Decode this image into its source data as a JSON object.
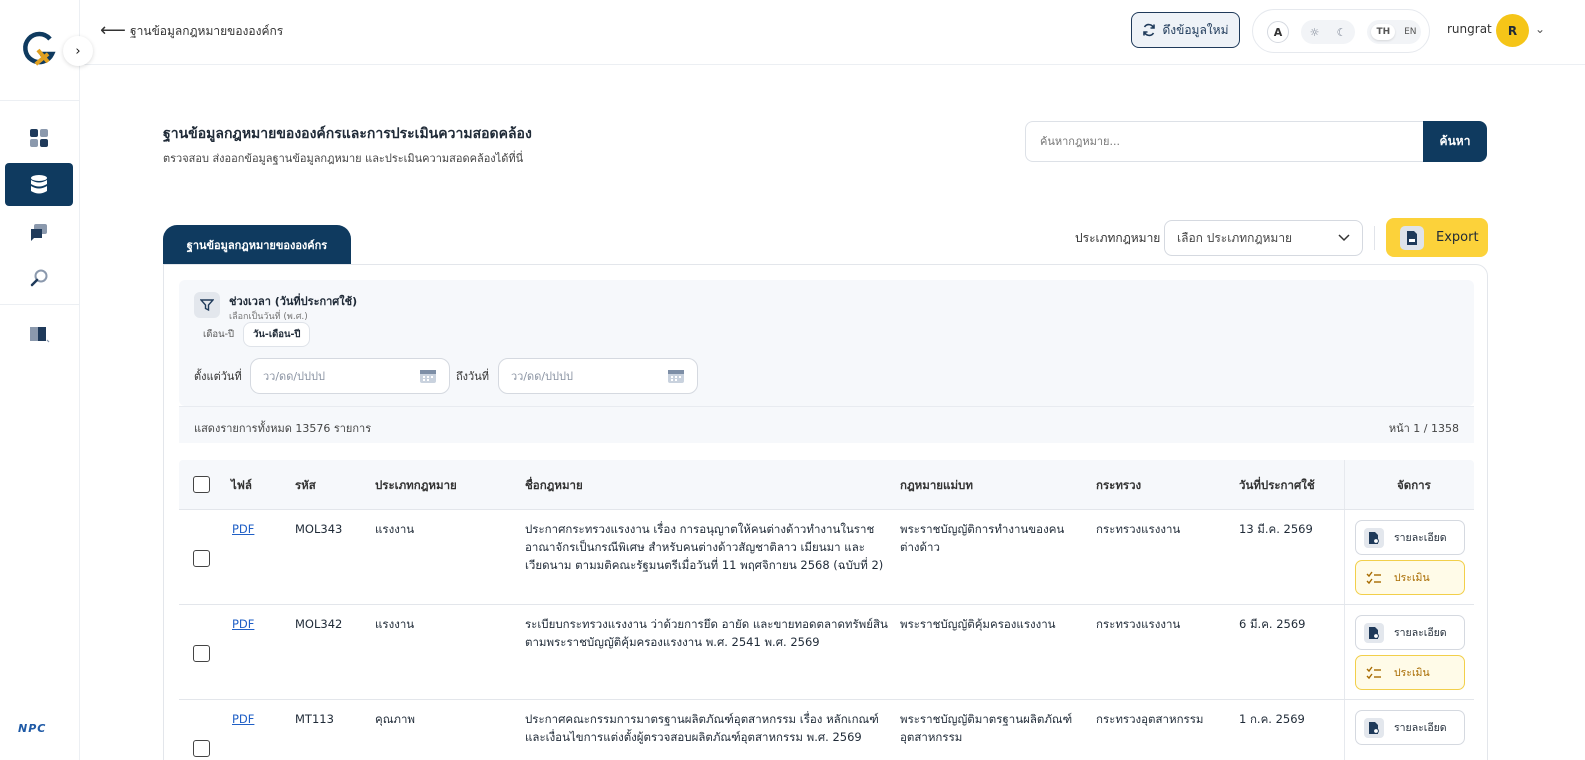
{
  "topbar": {
    "breadcrumb": "ฐานข้อมูลกฎหมายขององค์กร",
    "refresh_label": "ดึงข้อมูลใหม่",
    "font_toggle": "A",
    "lang_th": "TH",
    "lang_en": "EN",
    "username": "rungrat",
    "avatar_initial": "R"
  },
  "sidebar": {
    "brand": "NPC",
    "items": [
      {
        "icon": "dashboard-icon",
        "active": false
      },
      {
        "icon": "database-icon",
        "active": true
      },
      {
        "icon": "chat-icon",
        "active": false
      },
      {
        "icon": "search-icon",
        "active": false
      },
      {
        "icon": "book-icon",
        "active": false
      }
    ]
  },
  "header": {
    "title": "ฐานข้อมูลกฎหมายขององค์กรและการประเมินความสอดคล้อง",
    "subtitle": "ตรวจสอบ ส่งออกข้อมูลฐานข้อมูลกฎหมาย และประเมินความสอดคล้องได้ที่นี่",
    "search_placeholder": "ค้นหากฎหมาย...",
    "search_button": "ค้นหา"
  },
  "tab_label": "ฐานข้อมูลกฎหมายขององค์กร",
  "filter": {
    "type_label": "ประเภทกฎหมาย",
    "type_select_value": "เลือก ประเภทกฎหมาย",
    "export_label": "Export",
    "period_title": "ช่วงเวลา (วันที่ประกาศใช้)",
    "period_sub": "เลือกเป็นวันที่ (พ.ศ.)",
    "seg_month_year": "เดือน-ปี",
    "seg_day_month_year": "วัน-เดือน-ปี",
    "from_label": "ตั้งแต่วันที่",
    "to_label": "ถึงวันที่",
    "date_placeholder": "วว/ดด/ปปปป"
  },
  "summary": {
    "total_text": "แสดงรายการทั้งหมด 13576 รายการ",
    "page_text": "หน้า 1 / 1358"
  },
  "table": {
    "headers": {
      "file": "ไฟล์",
      "code": "รหัส",
      "type": "ประเภทกฎหมาย",
      "name": "ชื่อกฎหมาย",
      "parent": "กฎหมายแม่บท",
      "ministry": "กระทรวง",
      "date": "วันที่ประกาศใช้",
      "manage": "จัดการ"
    },
    "detail_label": "รายละเอียด",
    "assess_label": "ประเมิน",
    "rows": [
      {
        "file": "PDF",
        "code": "MOL343",
        "type": "แรงงาน",
        "name_lines": [
          "ประกาศกระทรวงแรงงาน เรื่อง การอนุญาตให้คนต่างด้าวทำงานในราช",
          "อาณาจักรเป็นกรณีพิเศษ สำหรับคนต่างด้าวสัญชาติลาว เมียนมา และ",
          "เวียดนาม ตามมติคณะรัฐมนตรีเมื่อวันที่ 11 พฤศจิกายน 2568 (ฉบับที่ 2)"
        ],
        "parent_lines": [
          "พระราชบัญญัติการทำงานของคน",
          "ต่างด้าว"
        ],
        "ministry": "กระทรวงแรงงาน",
        "date": "13 มี.ค. 2569"
      },
      {
        "file": "PDF",
        "code": "MOL342",
        "type": "แรงงาน",
        "name_lines": [
          "ระเบียบกระทรวงแรงงาน ว่าด้วยการยึด อายัด และขายทอดตลาดทรัพย์สิน",
          "ตามพระราชบัญญัติคุ้มครองแรงงาน พ.ศ. 2541 พ.ศ. 2569"
        ],
        "parent_lines": [
          "พระราชบัญญัติคุ้มครองแรงงาน"
        ],
        "ministry": "กระทรวงแรงงาน",
        "date": "6 มี.ค. 2569"
      },
      {
        "file": "PDF",
        "code": "MT113",
        "type": "คุณภาพ",
        "name_lines": [
          "ประกาศคณะกรรมการมาตรฐานผลิตภัณฑ์อุตสาหกรรม เรื่อง หลักเกณฑ์",
          "และเงื่อนไขการแต่งตั้งผู้ตรวจสอบผลิตภัณฑ์อุตสาหกรรม พ.ศ. 2569"
        ],
        "parent_lines": [
          "พระราชบัญญัติมาตรฐานผลิตภัณฑ์",
          "อุตสาหกรรม"
        ],
        "ministry": "กระทรวงอุตสาหกรรม",
        "date": "1 ก.ค. 2569"
      }
    ]
  },
  "colors": {
    "primary": "#0f3a5f",
    "accent_yellow": "#fcd23a",
    "link": "#1f5fc6"
  }
}
